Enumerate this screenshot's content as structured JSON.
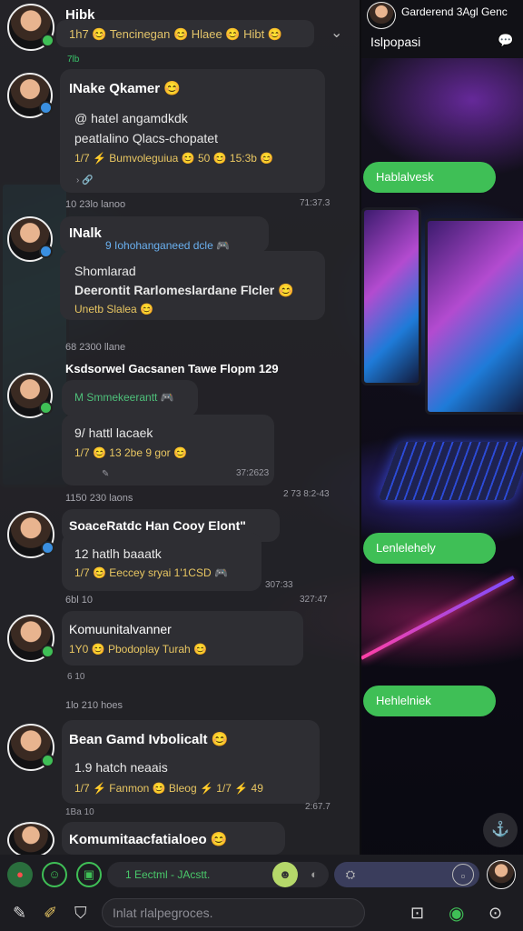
{
  "header": {
    "name": "Hibk",
    "status": "1h7 😊 Tencinegan 😊 Hlaee 😊 Hibt 😊",
    "status_meta": "7lb"
  },
  "right_header": {
    "title": "Garderend 3Agl Genc",
    "subtitle": "Islpopasi"
  },
  "right_pills": [
    "Hablalvesk",
    "Lenlelehely",
    "Hehlelniek"
  ],
  "messages": [
    {
      "name": "INake Qkamer 😊",
      "lines": [
        "@ hatel angamdkdk",
        "peatlalino Qlacs-chopatet"
      ],
      "stats": "1/7 ⚡ Bumvoleguiua 😊 50 😊 15:3b 😊",
      "meta": "10    23lo lanoo",
      "time": "71:37.3"
    },
    {
      "name": "INalk",
      "badge": "9 Iohohanganeed dcle 🎮",
      "lines": [
        "Shomlarad",
        "Deerontit Rarlomeslardane Flcler 😊"
      ],
      "stats": "Unetb Slalea 😊",
      "meta": "68    2300 llane"
    },
    {
      "name": "Ksdsorwel Gacsanen Tawe Flopm 129",
      "badge": "M Smmekeerantt 🎮",
      "lines": [
        "9/ hattl lacaek"
      ],
      "stats": "1/7 😊 13 2be 9 gor 😊",
      "meta": "1150   230 laons",
      "time": "37:2623",
      "time2": "2 73 8:2-43"
    },
    {
      "name": "SoaceRatdc Han Cooy Elont\"",
      "lines": [
        "12 hatlh baaatk"
      ],
      "stats": "1/7 😊 Eeccey sryai 1'1CSD 🎮",
      "meta": "6bl    10",
      "time": "307:33",
      "time2": "327:47"
    },
    {
      "name": "Komuunitalvanner",
      "lines": [],
      "stats": "1Y0 😊 Pbodoplay Turah 😊",
      "meta": "6    10",
      "sep": "1lo   210 hoes"
    },
    {
      "name": "Bean Gamd Ivbolicalt 😊",
      "lines": [
        "1.9 hatch neaais"
      ],
      "stats": "1/7 ⚡ Fanmon 😊 Bleog ⚡ 1/7 ⚡ 49",
      "meta": "1Ba   10",
      "time": "2:67.7"
    },
    {
      "name": "Komumitaacfatialoeo 😊",
      "lines": []
    }
  ],
  "composer": {
    "draft": "1 Eectml - JAcstt.",
    "placeholder": "Inlat rlalpegroces."
  },
  "icons": [
    "chevron-down-icon",
    "chat-icon",
    "pencil-icon",
    "shield-icon",
    "emoji-icon",
    "send-icon",
    "mic-icon",
    "add-icon"
  ],
  "colors": {
    "accent_green": "#3fbf56",
    "panel_bg": "#26262a",
    "gold_text": "#e8c662"
  }
}
